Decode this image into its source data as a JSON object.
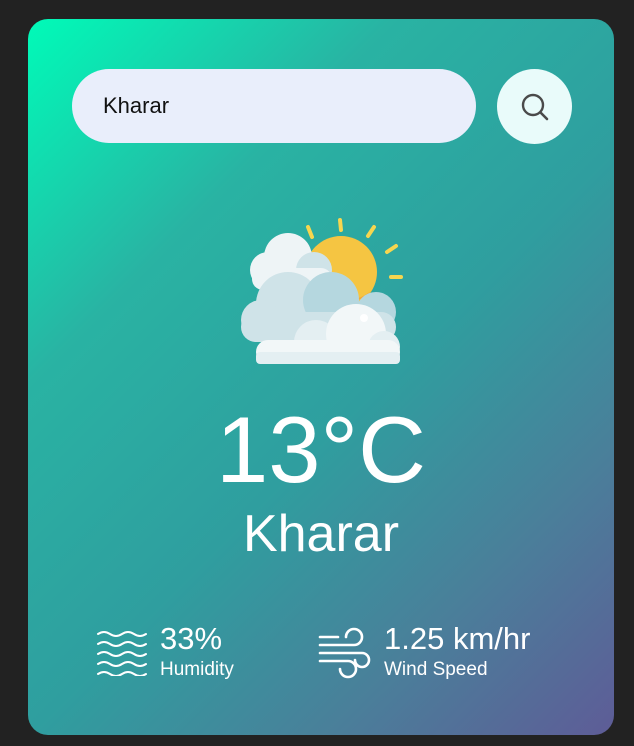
{
  "search": {
    "value": "Kharar",
    "button_icon": "search-icon"
  },
  "weather": {
    "icon": "sun-behind-clouds-icon",
    "temperature": "13°C",
    "city": "Kharar"
  },
  "humidity": {
    "icon": "humidity-waves-icon",
    "value": "33%",
    "label": "Humidity"
  },
  "wind": {
    "icon": "wind-icon",
    "value": "1.25 km/hr",
    "label": "Wind Speed"
  },
  "colors": {
    "page_background": "#222222",
    "gradient_start": "#00fbb8",
    "gradient_end": "#5e5c97",
    "search_background": "#e9eefb",
    "text": "#ffffff"
  }
}
